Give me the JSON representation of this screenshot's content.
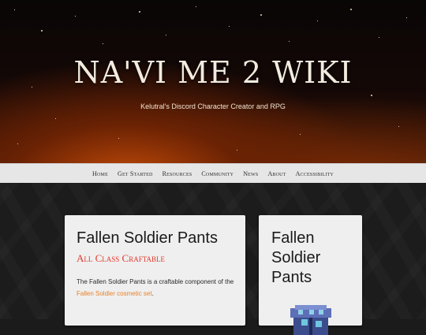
{
  "header": {
    "title": "NA'VI ME 2 WIKI",
    "tagline": "Kelutral's Discord Character Creator and RPG"
  },
  "nav": {
    "items": [
      {
        "label": "Home"
      },
      {
        "label": "Get Started"
      },
      {
        "label": "Resources"
      },
      {
        "label": "Community"
      },
      {
        "label": "News"
      },
      {
        "label": "About"
      },
      {
        "label": "Accessibility"
      }
    ]
  },
  "article": {
    "title": "Fallen Soldier Pants",
    "subtitle": "All Class Craftable",
    "intro_prefix": "The Fallen Soldier Pants is a craftable component of the ",
    "intro_link": "Fallen Soldier cosmetic set",
    "intro_suffix": "."
  },
  "infobox": {
    "title": "Fallen Soldier Pants",
    "image_icon": "pixel-pants-sprite-icon"
  },
  "colors": {
    "accent_red": "#e2372c",
    "link_orange": "#e8822a",
    "nav_bg": "#e6e6e6",
    "hero_glow": "#c24a07"
  }
}
